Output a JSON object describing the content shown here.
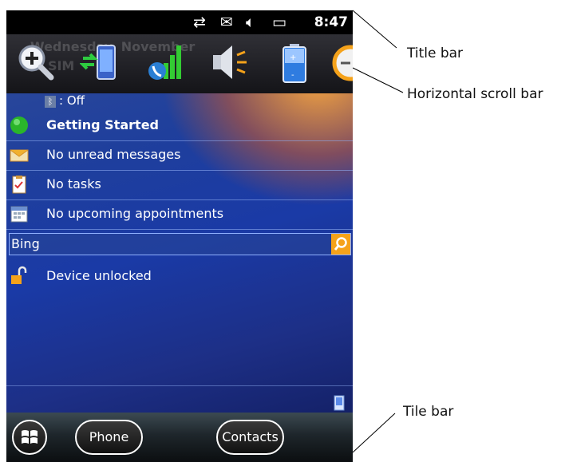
{
  "status_bar": {
    "time": "8:47",
    "icons": [
      "sync-arrows-icon",
      "message-icon",
      "speaker-icon",
      "battery-charging-icon"
    ]
  },
  "scroll_bar": {
    "background_text": [
      "Wednesday, November",
      "No SIM"
    ],
    "quick_icons": [
      "zoom-in-icon",
      "connection-setup-icon",
      "signal-phone-icon",
      "volume-icon",
      "battery-icon",
      "clock-icon"
    ]
  },
  "today": {
    "bluetooth_status": ": Off",
    "items": [
      {
        "label": "Getting Started",
        "icon": "getting-started-icon",
        "bold": true
      },
      {
        "label": "No unread messages",
        "icon": "envelope-icon"
      },
      {
        "label": "No tasks",
        "icon": "tasks-icon"
      },
      {
        "label": "No upcoming appointments",
        "icon": "calendar-icon"
      }
    ],
    "search": {
      "value": "Bing"
    },
    "lock_status": "Device unlocked"
  },
  "tile_bar": {
    "start_button": "windows-start-icon",
    "left_softkey": "Phone",
    "right_softkey": "Contacts"
  },
  "annotations": {
    "title_bar": "Title bar",
    "horizontal_scroll_bar": "Horizontal scroll bar",
    "tile_bar": "Tile bar"
  },
  "colors": {
    "accent_orange": "#f5a21a",
    "wallpaper_blue": "#1a3aa6",
    "row_divider": "#8caaf0"
  }
}
